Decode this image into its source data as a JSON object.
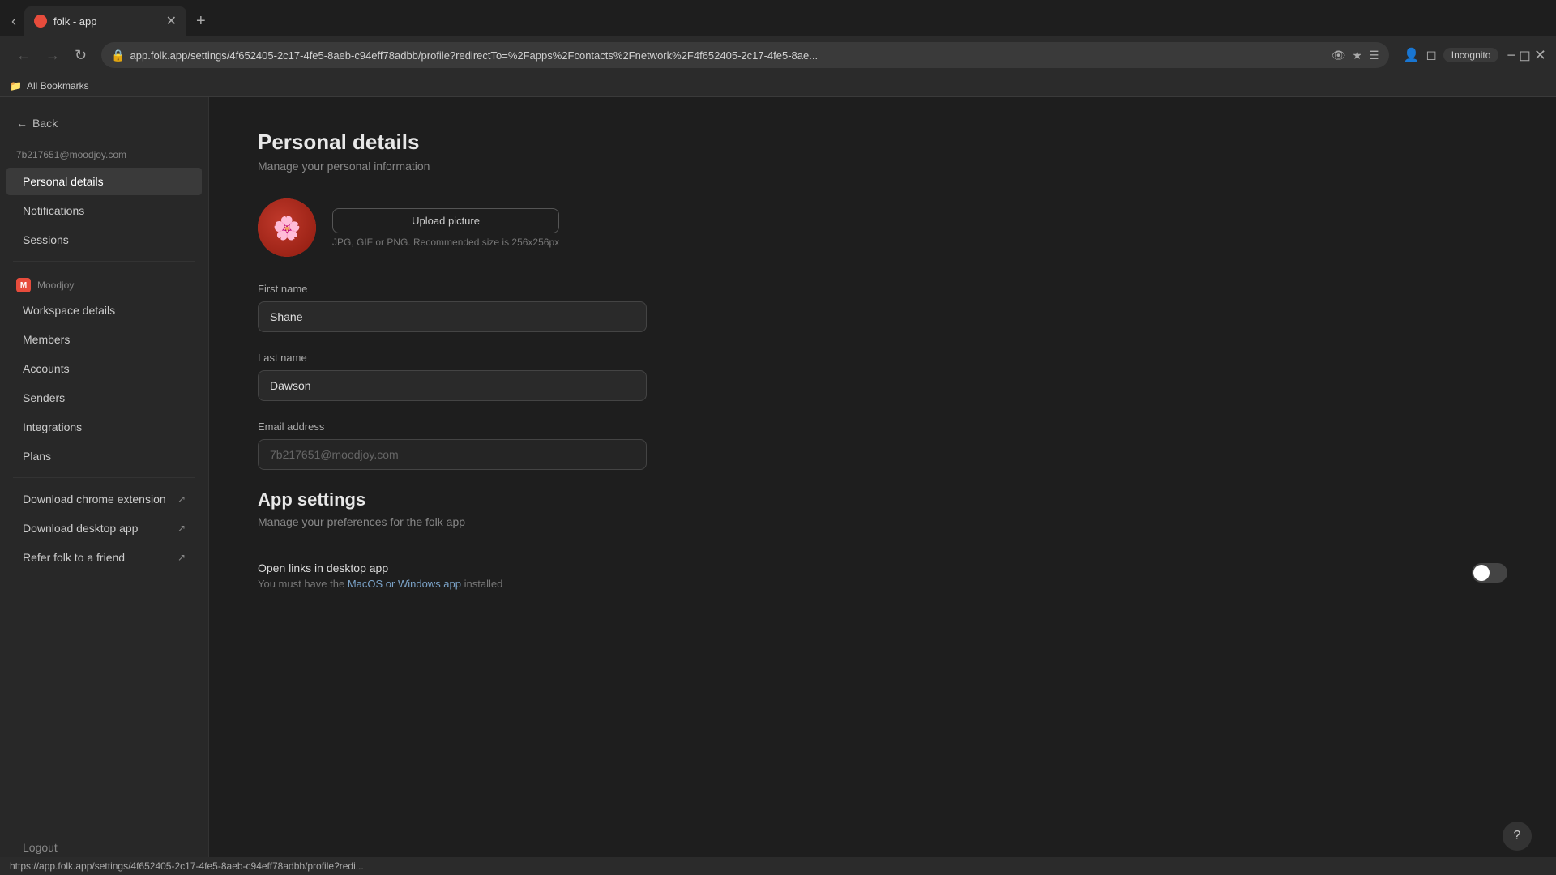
{
  "browser": {
    "tab_title": "folk - app",
    "address": "app.folk.app/settings/4f652405-2c17-4fe5-8aeb-c94eff78adbb/profile?redirectTo=%2Fapps%2Fcontacts%2Fnetwork%2F4f652405-2c17-4fe5-8ae...",
    "incognito_label": "Incognito",
    "bookmarks_label": "All Bookmarks",
    "status_url": "https://app.folk.app/settings/4f652405-2c17-4fe5-8aeb-c94eff78adbb/profile?redi..."
  },
  "sidebar": {
    "back_label": "Back",
    "user_email": "7b217651@moodjoy.com",
    "items_personal": [
      {
        "id": "personal-details",
        "label": "Personal details",
        "active": true
      },
      {
        "id": "notifications",
        "label": "Notifications",
        "active": false
      },
      {
        "id": "sessions",
        "label": "Sessions",
        "active": false
      }
    ],
    "workspace_name": "Moodjoy",
    "workspace_icon": "M",
    "items_workspace": [
      {
        "id": "workspace-details",
        "label": "Workspace details",
        "external": false
      },
      {
        "id": "members",
        "label": "Members",
        "external": false
      },
      {
        "id": "accounts",
        "label": "Accounts",
        "external": false
      },
      {
        "id": "senders",
        "label": "Senders",
        "external": false
      },
      {
        "id": "integrations",
        "label": "Integrations",
        "external": false
      },
      {
        "id": "plans",
        "label": "Plans",
        "external": false
      }
    ],
    "items_external": [
      {
        "id": "download-chrome",
        "label": "Download chrome extension",
        "external": true
      },
      {
        "id": "download-desktop",
        "label": "Download desktop app",
        "external": true
      },
      {
        "id": "refer-folk",
        "label": "Refer folk to a friend",
        "external": true
      }
    ],
    "logout_label": "Logout"
  },
  "main": {
    "page_title": "Personal details",
    "page_subtitle": "Manage your personal information",
    "upload_btn_label": "Upload picture",
    "picture_hint": "JPG, GIF or PNG. Recommended size is 256x256px",
    "first_name_label": "First name",
    "first_name_value": "Shane",
    "last_name_label": "Last name",
    "last_name_value": "Dawson",
    "email_label": "Email address",
    "email_value": "7b217651@moodjoy.com",
    "app_settings_title": "App settings",
    "app_settings_subtitle": "Manage your preferences for the folk app",
    "open_links_title": "Open links in desktop app",
    "open_links_desc_prefix": "You must have the ",
    "open_links_link_text": "MacOS or Windows app",
    "open_links_desc_suffix": " installed",
    "toggle_state": "off"
  },
  "help_btn": "?"
}
